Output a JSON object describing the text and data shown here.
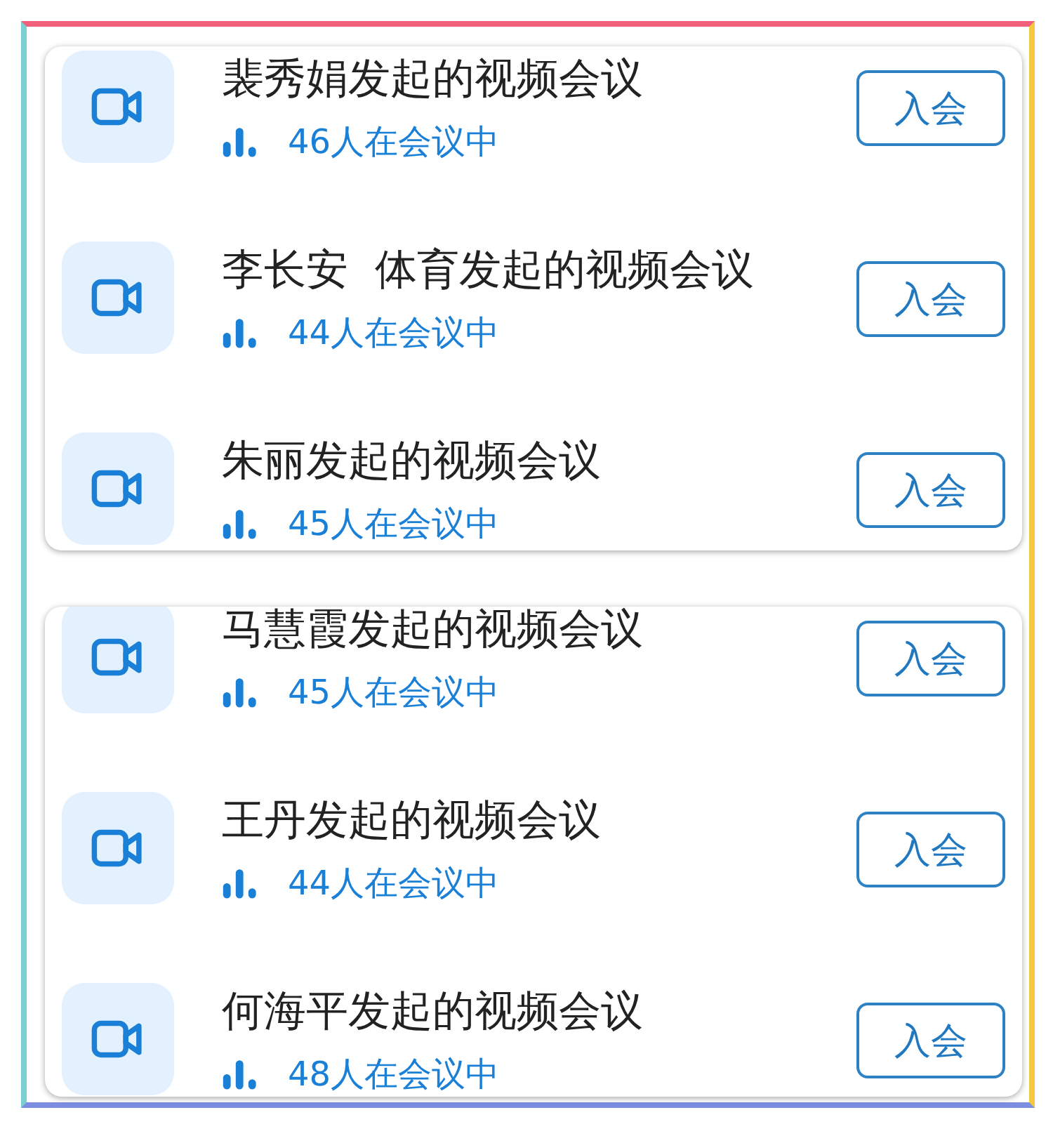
{
  "groups": [
    {
      "meetings": [
        {
          "title": "裴秀娟发起的视频会议",
          "participants": "46人在会议中",
          "button": "入会"
        },
        {
          "title": "李长安  体育发起的视频会议",
          "participants": "44人在会议中",
          "button": "入会"
        },
        {
          "title": "朱丽发起的视频会议",
          "participants": "45人在会议中",
          "button": "入会"
        }
      ]
    },
    {
      "meetings": [
        {
          "title": "马慧霞发起的视频会议",
          "participants": "45人在会议中",
          "button": "入会"
        },
        {
          "title": "王丹发起的视频会议",
          "participants": "44人在会议中",
          "button": "入会"
        },
        {
          "title": "何海平发起的视频会议",
          "participants": "48人在会议中",
          "button": "入会"
        }
      ]
    }
  ]
}
